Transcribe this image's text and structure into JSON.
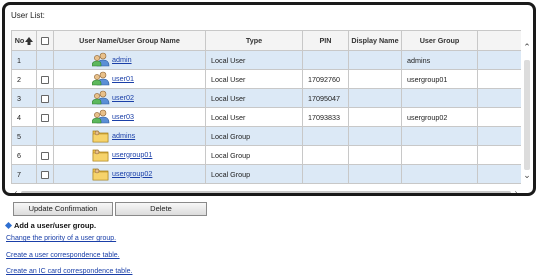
{
  "user_list": {
    "title": "User List:",
    "columns": {
      "no": "No",
      "name": "User Name/User Group Name",
      "type": "Type",
      "pin": "PIN",
      "display_name": "Display Name",
      "user_group": "User Group"
    },
    "rows": [
      {
        "no": "1",
        "checkbox": false,
        "icon": "user-icon",
        "name": "admin",
        "type": "Local User",
        "pin": "",
        "display_name": "",
        "user_group": "admins"
      },
      {
        "no": "2",
        "checkbox": true,
        "icon": "user-icon",
        "name": "user01",
        "type": "Local User",
        "pin": "17092760",
        "display_name": "",
        "user_group": "usergroup01"
      },
      {
        "no": "3",
        "checkbox": true,
        "icon": "user-icon",
        "name": "user02",
        "type": "Local User",
        "pin": "17095047",
        "display_name": "",
        "user_group": ""
      },
      {
        "no": "4",
        "checkbox": true,
        "icon": "user-icon",
        "name": "user03",
        "type": "Local User",
        "pin": "17093833",
        "display_name": "",
        "user_group": "usergroup02"
      },
      {
        "no": "5",
        "checkbox": false,
        "icon": "folder-icon",
        "name": "admins",
        "type": "Local Group",
        "pin": "",
        "display_name": "",
        "user_group": ""
      },
      {
        "no": "6",
        "checkbox": true,
        "icon": "folder-icon",
        "name": "usergroup01",
        "type": "Local Group",
        "pin": "",
        "display_name": "",
        "user_group": ""
      },
      {
        "no": "7",
        "checkbox": true,
        "icon": "folder-icon",
        "name": "usergroup02",
        "type": "Local Group",
        "pin": "",
        "display_name": "",
        "user_group": ""
      }
    ]
  },
  "buttons": {
    "update_confirmation": "Update Confirmation",
    "delete": "Delete"
  },
  "add_section": {
    "heading": "Add a user/user group."
  },
  "links": {
    "change_priority": "Change the priority of a user group.",
    "create_user_correspondence": "Create a user correspondence table.",
    "create_ic_card_correspondence": "Create an IC card correspondence table."
  },
  "colors": {
    "link": "#1a3fa8",
    "row_highlight": "#dce9f6",
    "frame_border": "#1a1a1a"
  }
}
